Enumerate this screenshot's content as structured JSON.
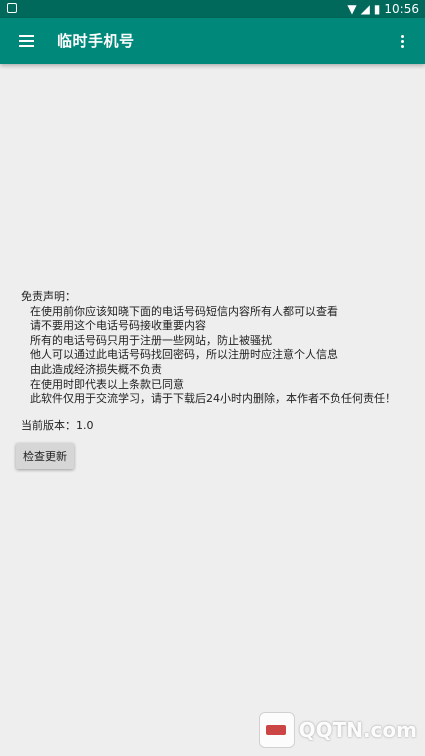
{
  "status_bar": {
    "time": "10:56"
  },
  "app_bar": {
    "title": "临时手机号"
  },
  "disclaimer": {
    "heading": "免责声明：",
    "lines": [
      "在使用前你应该知晓下面的电话号码短信内容所有人都可以查看",
      "请不要用这个电话号码接收重要内容",
      "所有的电话号码只用于注册一些网站，防止被骚扰",
      "他人可以通过此电话号码找回密码，所以注册时应注意个人信息",
      "由此造成经济损失概不负责",
      "在使用时即代表以上条款已同意",
      "此软件仅用于交流学习，请于下载后24小时内删除，本作者不负任何责任！"
    ]
  },
  "version": {
    "label": "当前版本：1.0"
  },
  "check_update": {
    "label": "检查更新"
  },
  "watermark": {
    "text": "QQTN.com"
  },
  "colors": {
    "status_bar": "#00695c",
    "app_bar": "#00897b",
    "background": "#eeeeee"
  },
  "icons": {
    "menu": "hamburger-menu-icon",
    "overflow": "more-vert-icon"
  }
}
